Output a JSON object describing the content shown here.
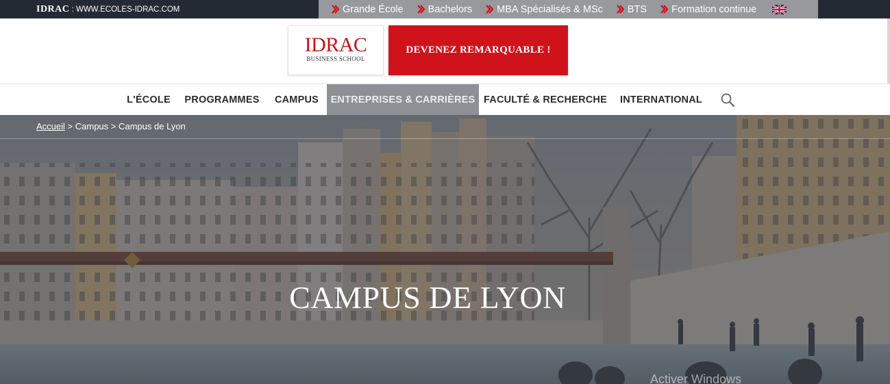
{
  "topbar": {
    "brand": "IDRAC",
    "url": " : WWW.ECOLES-IDRAC.COM",
    "links": [
      {
        "label": "Grande École"
      },
      {
        "label": "Bachelors"
      },
      {
        "label": "MBA Spécialisés & MSc"
      },
      {
        "label": "BTS"
      },
      {
        "label": "Formation continue"
      }
    ],
    "language_icon": "uk-flag-icon"
  },
  "header": {
    "logo_word": "IDRAC",
    "logo_sub": "BUSINESS SCHOOL",
    "cta_label": "DEVENEZ REMARQUABLE !"
  },
  "nav": {
    "items": [
      {
        "label": "L'ÉCOLE"
      },
      {
        "label": "PROGRAMMES"
      },
      {
        "label": "CAMPUS"
      },
      {
        "label": "ENTREPRISES & CARRIÈRES",
        "active": true
      },
      {
        "label": "FACULTÉ & RECHERCHE"
      },
      {
        "label": "INTERNATIONAL"
      }
    ],
    "search_icon": "search-icon"
  },
  "breadcrumb": {
    "home": "Accueil",
    "sep1": " > ",
    "level1": "Campus",
    "sep2": " > ",
    "current": "Campus de Lyon"
  },
  "hero": {
    "title": "CAMPUS DE LYON",
    "watermark": "Activer Windows"
  },
  "colors": {
    "brand_red": "#d0131a",
    "topbar_dark": "#242a33",
    "topbar_links_bg": "#97999c",
    "nav_active_bg": "#8d9196"
  }
}
